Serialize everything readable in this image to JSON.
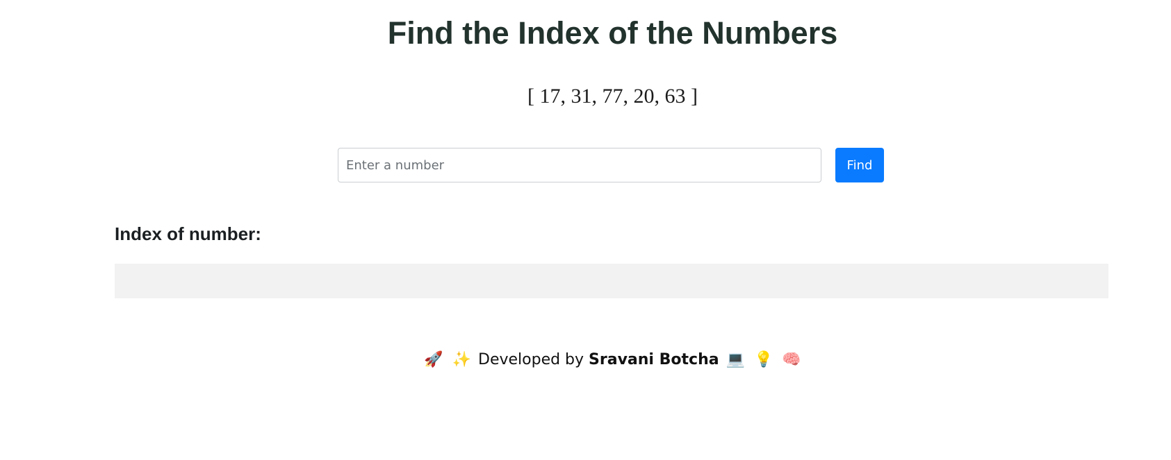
{
  "header": {
    "title": "Find the Index of the Numbers",
    "numbers_text": "[ 17, 31, 77, 20, 63 ]"
  },
  "search": {
    "placeholder": "Enter a number",
    "value": "",
    "button_label": "Find"
  },
  "result": {
    "label": "Index of number:",
    "value": ""
  },
  "footer": {
    "emoji_left_1": "🚀",
    "emoji_left_2": "✨",
    "prefix": "Developed by",
    "author": "Sravani Botcha",
    "emoji_right_1": "💻",
    "emoji_right_2": "💡",
    "emoji_right_3": "🧠"
  },
  "colors": {
    "title": "#22322d",
    "button_bg": "#0a7bff",
    "result_bg": "#f2f2f2"
  },
  "icons": {
    "footer_left": [
      "rocket-icon",
      "sparkles-icon"
    ],
    "footer_right": [
      "laptop-icon",
      "lightbulb-icon",
      "brain-icon"
    ]
  }
}
